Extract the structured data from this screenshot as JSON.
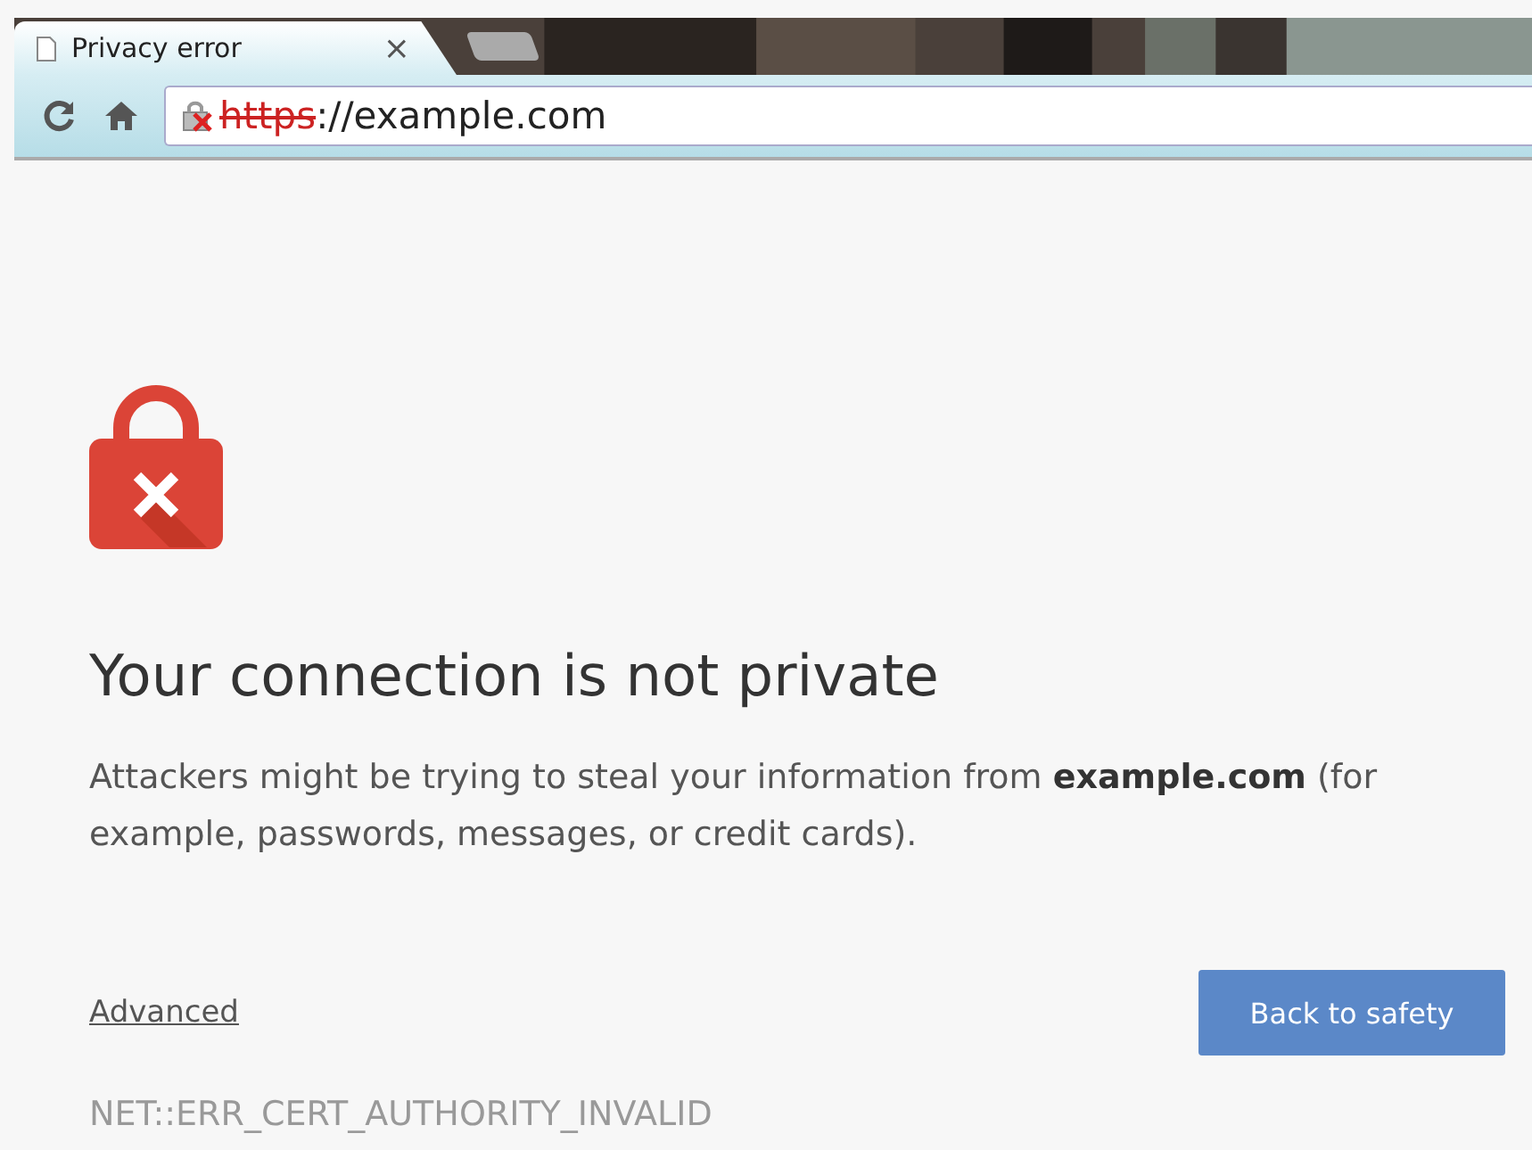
{
  "tab": {
    "title": "Privacy error",
    "close": "×",
    "selected": true
  },
  "address_bar": {
    "scheme": "https",
    "insecure": true,
    "rest": "://example.com"
  },
  "heading": "Your connection is not private",
  "message": "Attackers might be trying to steal your information from **example.com** (for example, passwords, messages, or credit cards).",
  "advanced_link": "Advanced",
  "back_button": "Back to safety",
  "error_code": "NET::ERR_CERT_AUTHORITY_INVALID"
}
